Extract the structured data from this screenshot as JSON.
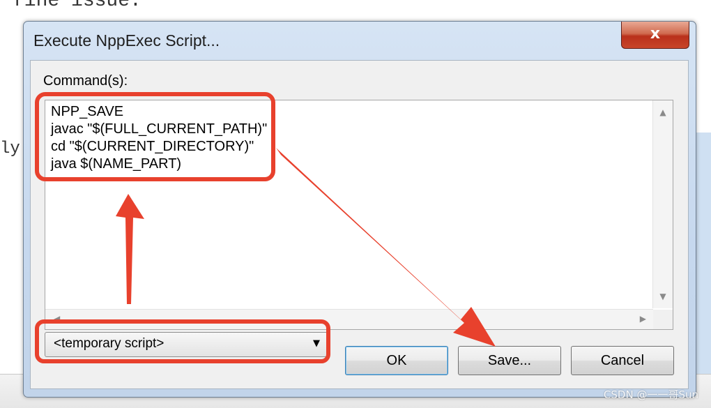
{
  "background": {
    "top_line": "fine issue.",
    "left_text": "ly"
  },
  "dialog": {
    "title": "Execute NppExec Script...",
    "close_label": "x",
    "command_label": "Command(s):",
    "commands": [
      "NPP_SAVE",
      "javac \"$(FULL_CURRENT_PATH)\"",
      "cd \"$(CURRENT_DIRECTORY)\"",
      "java $(NAME_PART)"
    ],
    "script_select": {
      "value": "<temporary script>"
    },
    "buttons": {
      "ok": "OK",
      "save": "Save...",
      "cancel": "Cancel"
    }
  },
  "watermark": "CSDN @一一哥Sun",
  "colors": {
    "annotation_red": "#e8412d",
    "dialog_frame": "#c6d8ee",
    "close_red": "#c8452a"
  }
}
